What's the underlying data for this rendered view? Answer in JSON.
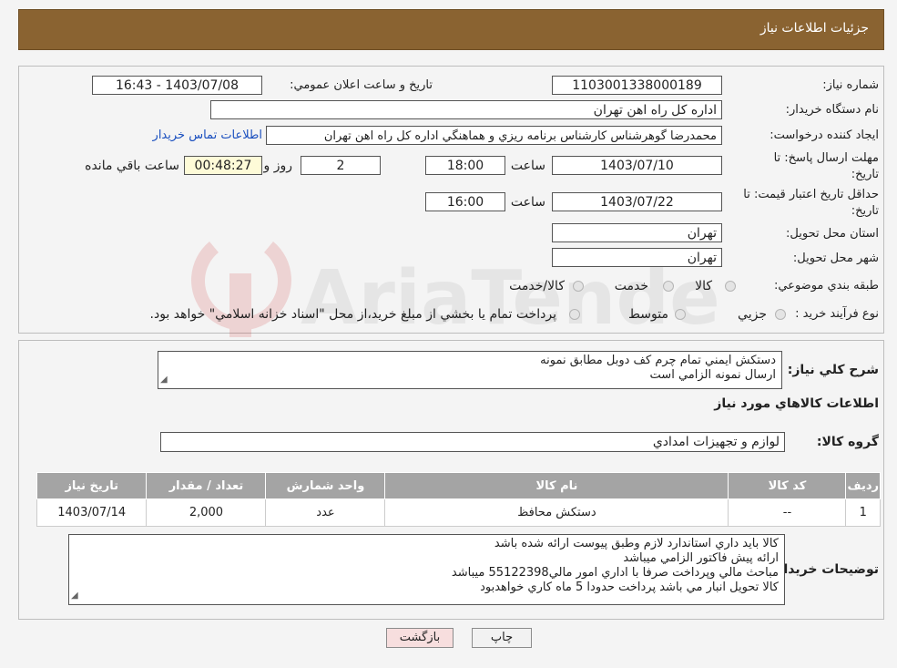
{
  "header": {
    "title": "جزئیات اطلاعات نیاز"
  },
  "fields": {
    "need_number_label": "شماره نیاز:",
    "need_number": "1103001338000189",
    "announce_label": "تاریخ و ساعت اعلان عمومي:",
    "announce_value": "1403/07/08 - 16:43",
    "buyer_org_label": "نام دستگاه خريدار:",
    "buyer_org": "اداره كل راه اهن تهران",
    "creator_label": "ايجاد كننده درخواست:",
    "creator": "محمدرضا گوهرشناس كارشناس برنامه ريزي و هماهنگي اداره كل راه اهن تهران",
    "contact_link": "اطلاعات تماس خريدار",
    "deadline_label_1": "مهلت ارسال پاسخ: تا",
    "deadline_label_2": "تاريخ:",
    "deadline_date": "1403/07/10",
    "time_label": "ساعت",
    "deadline_time": "18:00",
    "days_value": "2",
    "days_label": "روز و",
    "remaining_time": "00:48:27",
    "remaining_label": "ساعت باقي مانده",
    "validity_label_1": "حداقل تاريخ اعتبار قيمت: تا",
    "validity_label_2": "تاريخ:",
    "validity_date": "1403/07/22",
    "validity_time": "16:00",
    "province_label": "استان محل تحويل:",
    "province": "تهران",
    "city_label": "شهر محل تحويل:",
    "city": "تهران",
    "category_label": "طبقه بندي موضوعي:",
    "category_options": [
      "كالا",
      "خدمت",
      "كالا/خدمت"
    ],
    "process_label": "نوع فرآيند خريد :",
    "process_options": [
      "جزيي",
      "متوسط"
    ],
    "payment_note": "پرداخت تمام يا بخشي از مبلغ خريد،از محل \"اسناد خزانه اسلامي\" خواهد بود."
  },
  "description": {
    "label": "شرح كلي نياز:",
    "lines": [
      "دستكش ايمني تمام چرم كف دوبل مطابق نمونه",
      "ارسال نمونه الزامي است"
    ]
  },
  "goods": {
    "section_title": "اطلاعات كالاهاي مورد نياز",
    "group_label": "گروه كالا:",
    "group_value": "لوازم و تجهيزات امدادي",
    "columns": [
      "رديف",
      "كد كالا",
      "نام كالا",
      "واحد شمارش",
      "تعداد / مقدار",
      "تاريخ نياز"
    ],
    "rows": [
      [
        "1",
        "--",
        "دستكش محافظ",
        "عدد",
        "2,000",
        "1403/07/14"
      ]
    ]
  },
  "buyer_notes": {
    "label": "توضيحات خريدار:",
    "lines": [
      "كالا بايد داري استاندارد لازم وطبق پيوست ارائه شده باشد",
      "ارائه پيش فاكتور الزامي ميباشد",
      "مباحث مالي وپرداخت صرفا با اداري امور مالي55122398 ميباشد",
      "كالا تحويل انبار مي باشد پرداخت حدودا 5 ماه كاري خواهدبود"
    ]
  },
  "buttons": {
    "print": "چاپ",
    "back": "بازگشت"
  },
  "watermark": "AriaTender.neT",
  "colors": {
    "header": "#8a6331",
    "table_header": "#a4a4a4",
    "link": "#1a4fbf",
    "back_button": "#f7dede"
  }
}
